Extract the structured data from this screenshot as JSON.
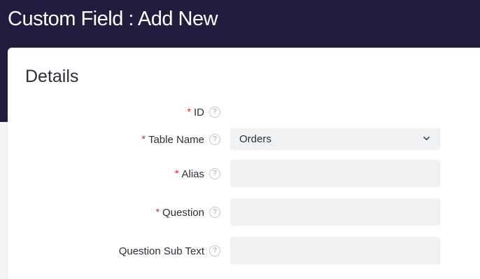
{
  "page": {
    "title": "Custom Field : Add New"
  },
  "details": {
    "title": "Details",
    "fields": {
      "id": {
        "label": "ID",
        "required": "*"
      },
      "table_name": {
        "label": "Table Name",
        "required": "*",
        "value": "Orders"
      },
      "alias": {
        "label": "Alias",
        "required": "*",
        "value": ""
      },
      "question": {
        "label": "Question",
        "required": "*",
        "value": ""
      },
      "question_sub_text": {
        "label": "Question Sub Text",
        "value": ""
      }
    },
    "help_glyph": "?"
  },
  "colors": {
    "header_bg": "#221d3f",
    "required_marker": "#e11d2e",
    "input_bg": "#f1f2f4"
  },
  "icons": {
    "help": "question-circle-icon",
    "dropdown": "chevron-down-icon"
  }
}
